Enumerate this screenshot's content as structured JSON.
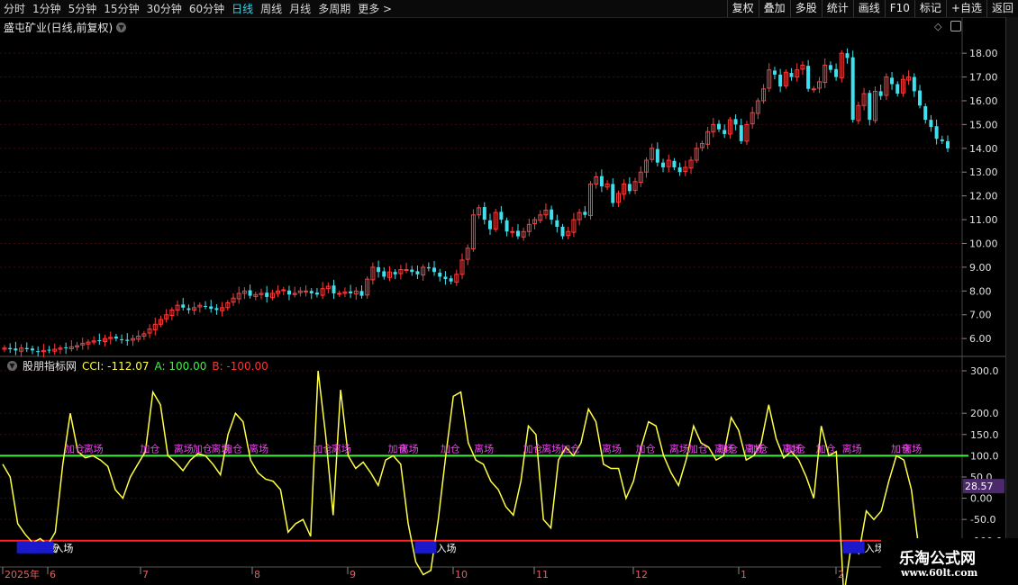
{
  "toolbar": {
    "periods": [
      "分时",
      "1分钟",
      "5分钟",
      "15分钟",
      "30分钟",
      "60分钟",
      "日线",
      "周线",
      "月线",
      "多周期",
      "更多 >"
    ],
    "active_period": "日线",
    "right_buttons": [
      "复权",
      "叠加",
      "多股",
      "统计",
      "画线",
      "F10",
      "标记",
      "+自选",
      "返回"
    ]
  },
  "main_chart": {
    "title": "盛屯矿业(日线,前复权)",
    "price_ticks": [
      "18.00",
      "17.00",
      "16.00",
      "15.00",
      "14.00",
      "13.00",
      "12.00",
      "11.00",
      "10.00",
      "9.00",
      "8.00",
      "7.00",
      "6.00"
    ]
  },
  "indicator": {
    "name": "股朋指标网",
    "cci_label": "CCI: -112.07",
    "a_label": "A: 100.00",
    "b_label": "B: -100.00",
    "ticks": [
      "300.0",
      "200.0",
      "150.0",
      "100.0",
      "50.0",
      "0.00",
      "-50.0",
      "-100.0"
    ],
    "current_value": "28.57",
    "signal_words": {
      "add": "加仓",
      "leave": "离场",
      "enter": "入场"
    }
  },
  "date_axis": {
    "labels": [
      "2025年",
      "6",
      "7",
      "8",
      "9",
      "10",
      "11",
      "12",
      "1",
      "2"
    ]
  },
  "watermark": {
    "name": "乐淘公式网",
    "url": "www.60lt.com"
  },
  "colors": {
    "up": "#ff3c3c",
    "down": "#3ee0ee",
    "cci": "#ffff44",
    "line_a": "#44ee44",
    "line_b": "#ff2222",
    "signal_text": "#ee44ee",
    "active_tab": "#38d1e6"
  },
  "chart_data": [
    {
      "type": "candlestick",
      "title": "盛屯矿业(日线,前复权)",
      "ylim": [
        5.4,
        18.8
      ],
      "close_series": [
        5.6,
        5.55,
        5.5,
        5.6,
        5.55,
        5.5,
        5.45,
        5.5,
        5.5,
        5.55,
        5.6,
        5.6,
        5.65,
        5.7,
        5.8,
        5.85,
        5.9,
        5.9,
        6.0,
        6.05,
        6.0,
        5.95,
        5.9,
        6.0,
        6.1,
        6.2,
        6.4,
        6.6,
        6.8,
        7.0,
        7.2,
        7.4,
        7.3,
        7.2,
        7.3,
        7.4,
        7.35,
        7.25,
        7.2,
        7.3,
        7.5,
        7.7,
        7.9,
        8.0,
        7.8,
        7.85,
        7.9,
        7.75,
        7.9,
        8.0,
        8.05,
        7.85,
        7.9,
        8.0,
        8.0,
        7.9,
        7.85,
        8.1,
        8.2,
        7.9,
        7.9,
        7.95,
        7.9,
        8.0,
        7.8,
        8.5,
        9.0,
        8.8,
        8.6,
        8.8,
        8.7,
        8.9,
        8.9,
        8.8,
        8.7,
        9.0,
        8.95,
        8.8,
        8.6,
        8.5,
        8.4,
        8.7,
        9.3,
        9.8,
        11.2,
        11.5,
        11.0,
        10.6,
        11.3,
        11.0,
        10.5,
        10.5,
        10.3,
        10.5,
        10.8,
        11.0,
        11.2,
        11.4,
        11.0,
        10.7,
        10.3,
        10.5,
        11.0,
        11.3,
        11.2,
        12.5,
        12.8,
        12.4,
        12.5,
        11.7,
        12.1,
        12.5,
        12.2,
        12.6,
        13.0,
        13.5,
        14.0,
        13.4,
        13.2,
        13.5,
        13.2,
        13.0,
        13.2,
        13.5,
        14.0,
        14.2,
        14.7,
        15.0,
        14.8,
        14.6,
        15.2,
        15.0,
        14.3,
        15.0,
        15.5,
        16.0,
        16.5,
        17.3,
        17.1,
        16.6,
        17.2,
        17.0,
        17.3,
        17.5,
        16.5,
        16.5,
        16.8,
        17.5,
        17.3,
        17.0,
        18.0,
        17.8,
        15.2,
        15.8,
        16.3,
        15.2,
        16.4,
        16.2,
        17.0,
        16.7,
        16.3,
        16.9,
        17.0,
        16.4,
        15.8,
        15.2,
        14.9,
        14.4,
        14.3,
        14.0
      ],
      "cci_series": [
        80,
        50,
        -60,
        -85,
        -105,
        -95,
        -110,
        -80,
        80,
        200,
        110,
        95,
        100,
        90,
        75,
        20,
        0,
        50,
        80,
        110,
        250,
        220,
        100,
        85,
        65,
        90,
        105,
        100,
        80,
        55,
        150,
        200,
        180,
        90,
        60,
        45,
        40,
        20,
        -80,
        -60,
        -50,
        -90,
        300,
        150,
        -40,
        255,
        100,
        70,
        85,
        60,
        30,
        90,
        100,
        80,
        -60,
        -150,
        -180,
        -170,
        -50,
        100,
        240,
        250,
        130,
        90,
        80,
        40,
        20,
        -20,
        -40,
        40,
        170,
        150,
        -50,
        -70,
        90,
        120,
        100,
        130,
        210,
        180,
        80,
        70,
        70,
        0,
        40,
        120,
        180,
        170,
        100,
        60,
        30,
        90,
        170,
        130,
        120,
        90,
        100,
        190,
        160,
        90,
        100,
        130,
        220,
        140,
        95,
        110,
        90,
        50,
        0,
        170,
        100,
        110,
        -230,
        -110,
        -130,
        -30,
        -50,
        -30,
        40,
        100,
        90,
        20,
        -120,
        -180,
        -120,
        -115
      ],
      "ticks": [
        300,
        200,
        150,
        100,
        50,
        0,
        -50,
        -100
      ]
    }
  ]
}
